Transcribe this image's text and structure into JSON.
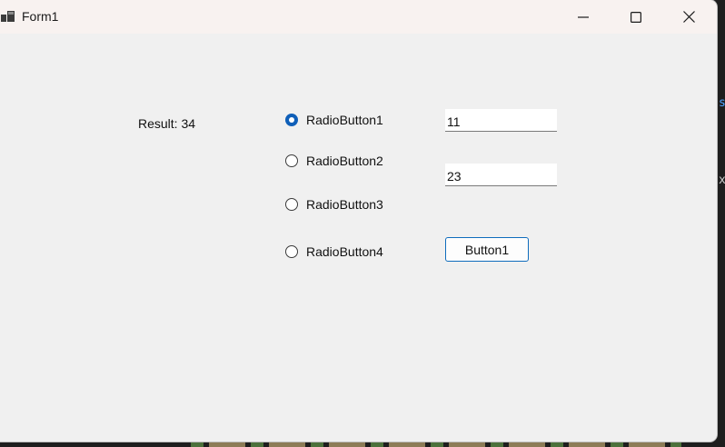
{
  "window": {
    "title": "Form1",
    "controls": {
      "minimize_icon": "minimize-icon",
      "maximize_icon": "maximize-icon",
      "close_icon": "close-icon"
    }
  },
  "form": {
    "result_label": "Result: 34",
    "radio_buttons": [
      {
        "label": "RadioButton1",
        "checked": true
      },
      {
        "label": "RadioButton2",
        "checked": false
      },
      {
        "label": "RadioButton3",
        "checked": false
      },
      {
        "label": "RadioButton4",
        "checked": false
      }
    ],
    "textbox1": {
      "value": "11"
    },
    "textbox2": {
      "value": "23"
    },
    "button1": {
      "label": "Button1"
    }
  },
  "colors": {
    "accent": "#0f5fb8",
    "button_border": "#0f6cbd",
    "titlebar_bg": "#f8f2f0",
    "client_bg": "#f0f0f0"
  }
}
